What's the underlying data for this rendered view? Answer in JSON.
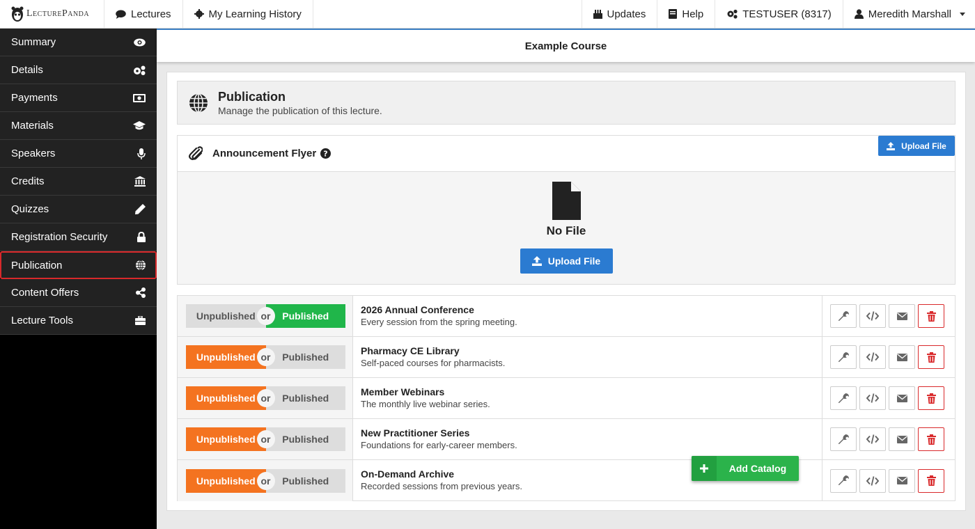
{
  "brand": {
    "name": "LecturePanda"
  },
  "nav": {
    "lectures": "Lectures",
    "history": "My Learning History",
    "updates": "Updates",
    "help": "Help",
    "account": "TESTUSER (8317)",
    "user": "Meredith Marshall"
  },
  "sidebar": {
    "items": [
      {
        "label": "Summary",
        "icon": "eye-icon"
      },
      {
        "label": "Details",
        "icon": "gears-icon"
      },
      {
        "label": "Payments",
        "icon": "money-icon"
      },
      {
        "label": "Materials",
        "icon": "graduation-cap-icon"
      },
      {
        "label": "Speakers",
        "icon": "microphone-icon"
      },
      {
        "label": "Credits",
        "icon": "institution-icon"
      },
      {
        "label": "Quizzes",
        "icon": "pencil-icon"
      },
      {
        "label": "Registration Security",
        "icon": "lock-icon"
      },
      {
        "label": "Publication",
        "icon": "globe-icon",
        "active": true
      },
      {
        "label": "Content Offers",
        "icon": "share-icon"
      },
      {
        "label": "Lecture Tools",
        "icon": "briefcase-icon"
      }
    ]
  },
  "course": {
    "title": "Example Course"
  },
  "publication": {
    "title": "Publication",
    "subtitle": "Manage the publication of this lecture."
  },
  "flyer": {
    "title": "Announcement Flyer",
    "upload_small": "Upload File",
    "empty_text": "No File",
    "upload_big": "Upload File"
  },
  "toggle": {
    "unpublished": "Unpublished",
    "or": "or",
    "published": "Published"
  },
  "catalogs": [
    {
      "name": "2026 Annual Conference",
      "desc": "Every session from the spring meeting.",
      "status": "published"
    },
    {
      "name": "Pharmacy CE Library",
      "desc": "Self-paced courses for pharmacists.",
      "status": "unpublished"
    },
    {
      "name": "Member Webinars",
      "desc": "The monthly live webinar series.",
      "status": "unpublished"
    },
    {
      "name": "New Practitioner Series",
      "desc": "Foundations for early-career members.",
      "status": "unpublished"
    },
    {
      "name": "On-Demand Archive",
      "desc": "Recorded sessions from previous years.",
      "status": "unpublished"
    }
  ],
  "add_catalog": "Add Catalog",
  "colors": {
    "published": "#20b64a",
    "unpublished": "#f47320",
    "primary": "#2b7bd1",
    "danger": "#d9292b"
  }
}
